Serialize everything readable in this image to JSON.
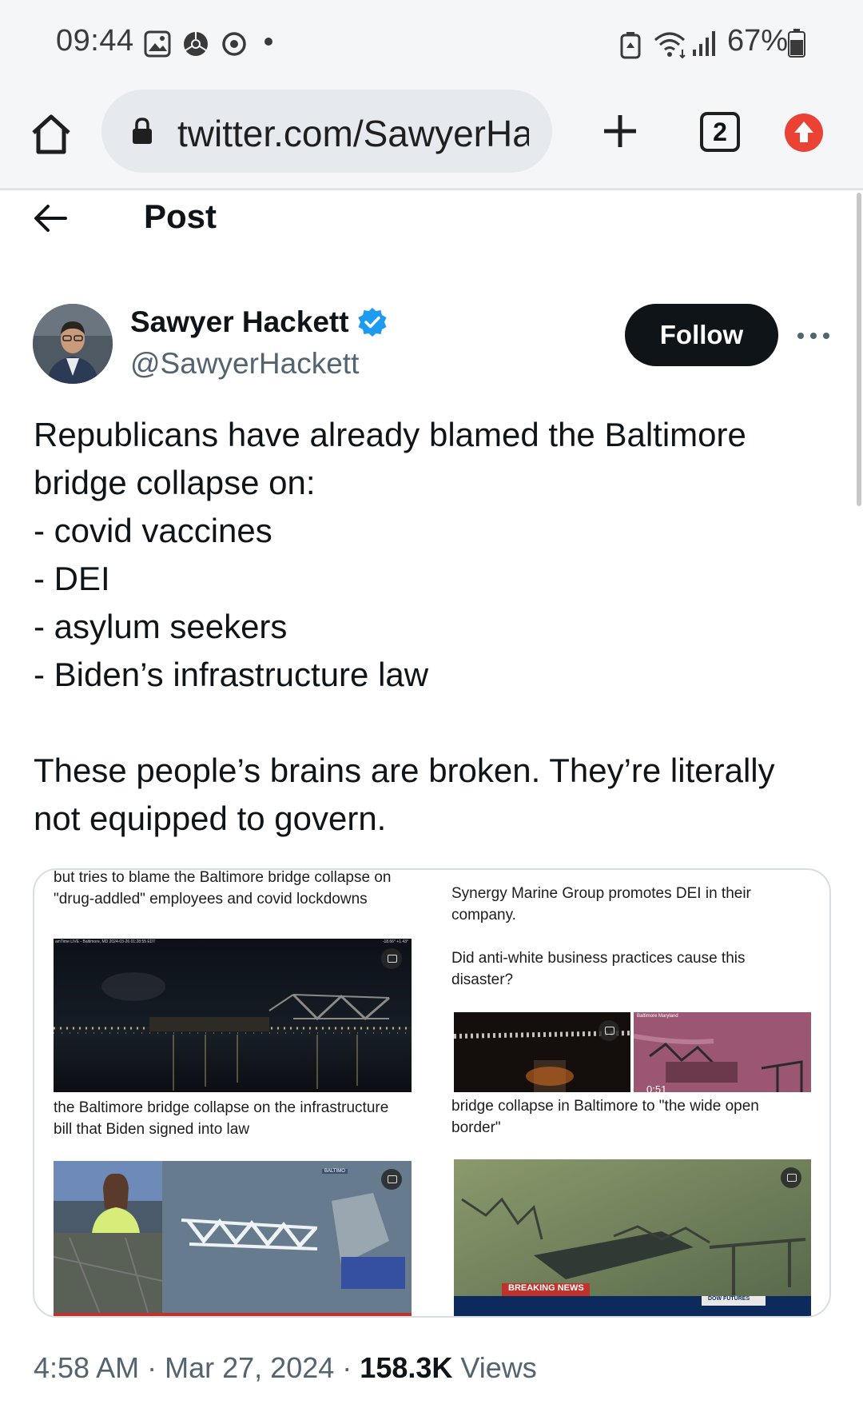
{
  "status_bar": {
    "time": "09:44",
    "battery": "67%",
    "left_icons": [
      "image-icon",
      "chrome-icon",
      "sync-icon",
      "dot-icon"
    ],
    "right_icons": [
      "vpn-icon",
      "wifi-icon",
      "signal-icon",
      "battery-icon"
    ]
  },
  "browser": {
    "url": "twitter.com/SawyerHa",
    "tab_count": "2"
  },
  "header": {
    "title": "Post"
  },
  "author": {
    "name": "Sawyer Hackett",
    "handle": "@SawyerHackett",
    "follow_label": "Follow",
    "verified_color": "#1d9bf0"
  },
  "tweet": {
    "lines": [
      "Republicans have already blamed the Baltimore",
      "bridge collapse on:",
      "- covid vaccines",
      "- DEI",
      "- asylum seekers",
      "- Biden’s infrastructure law",
      "",
      "These people’s brains are broken. They’re literally",
      "not equipped to govern."
    ]
  },
  "media": {
    "top_left_caption": "but tries to blame the Baltimore bridge collapse on \"drug-addled\" employees and covid lockdowns",
    "top_left_video_overlay": "amTime LIVE - Baltimore, MD 2024-03-26 01:28:55 EDT",
    "top_left_video_stat": "-18.66° +1.43°",
    "top_right_caption_1": "Synergy Marine Group promotes DEI in their company.",
    "top_right_caption_2": "Did anti-white business practices cause this disaster?",
    "top_right_thumb_label": "Baltimore Maryland",
    "top_right_duration": "0:51",
    "mid_left_caption": "the Baltimore bridge collapse on the infrastructure bill that Biden signed into law",
    "mid_right_caption": "bridge collapse in Baltimore to \"the wide open border\"",
    "bottom_left_tag": "BALTIMO",
    "bottom_right_breaking": "BREAKING NEWS",
    "bottom_right_ticker": "DOW FUTURES"
  },
  "meta": {
    "time": "4:58 AM",
    "sep1": "·",
    "date": "Mar 27, 2024",
    "sep2": "·",
    "views_count": "158.3K",
    "views_label": "Views"
  },
  "colors": {
    "follow_bg": "#0f1419",
    "accent_red": "#ea4335",
    "secondary_text": "#536471"
  }
}
